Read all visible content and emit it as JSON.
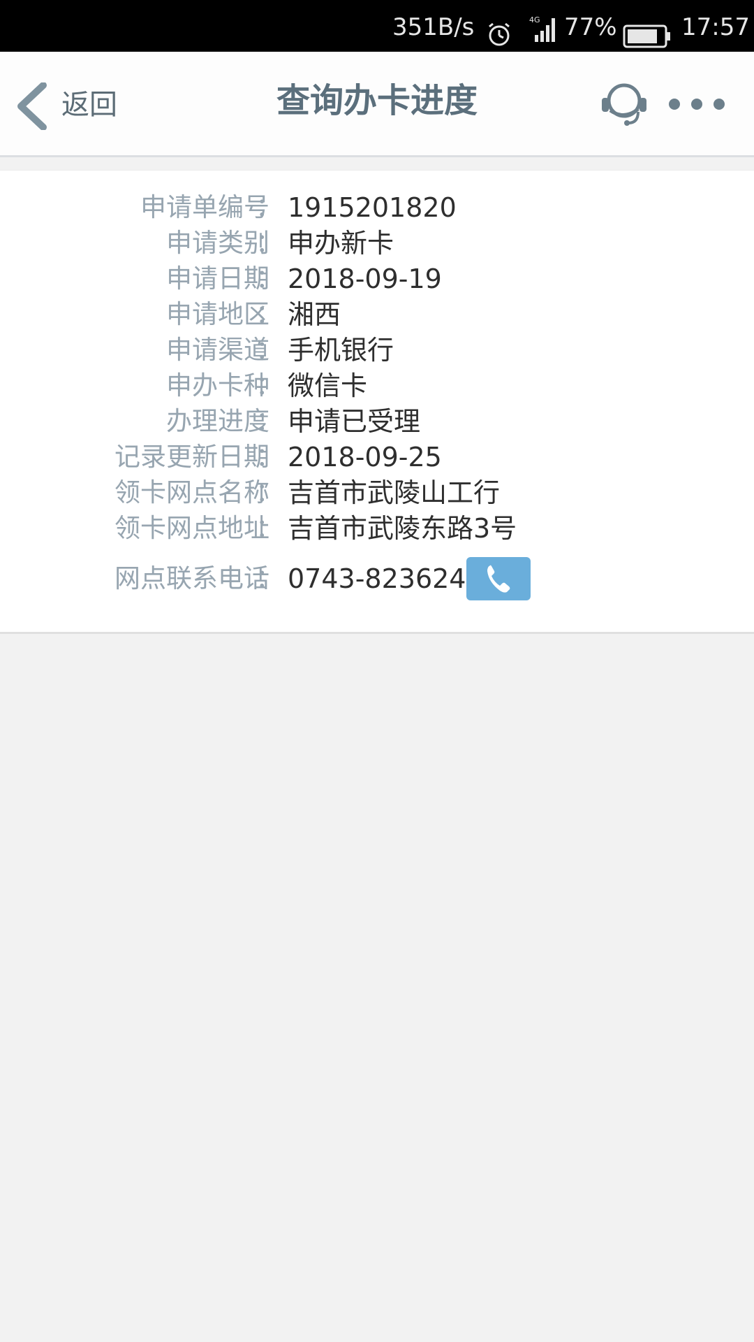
{
  "status_bar": {
    "net_speed": "351B/s",
    "network": "4G",
    "battery": "77%",
    "time": "17:57"
  },
  "header": {
    "back_label": "返回",
    "title": "查询办卡进度"
  },
  "details": [
    {
      "label": "申请单编号",
      "value": "1915201820"
    },
    {
      "label": "申请类别",
      "value": "申办新卡"
    },
    {
      "label": "申请日期",
      "value": "2018-09-19"
    },
    {
      "label": "申请地区",
      "value": "湘西"
    },
    {
      "label": "申请渠道",
      "value": "手机银行"
    },
    {
      "label": "申办卡种",
      "value": "微信卡"
    },
    {
      "label": "办理进度",
      "value": "申请已受理"
    },
    {
      "label": "记录更新日期",
      "value": "2018-09-25"
    },
    {
      "label": "领卡网点名称",
      "value": "吉首市武陵山工行"
    },
    {
      "label": "领卡网点地址",
      "value": "吉首市武陵东路3号"
    },
    {
      "label": "网点联系电话",
      "value": "0743-8236240"
    }
  ],
  "colon": "：",
  "colors": {
    "accent": "#6aaedb",
    "label": "#97a5b0",
    "title": "#5b6f7c"
  }
}
